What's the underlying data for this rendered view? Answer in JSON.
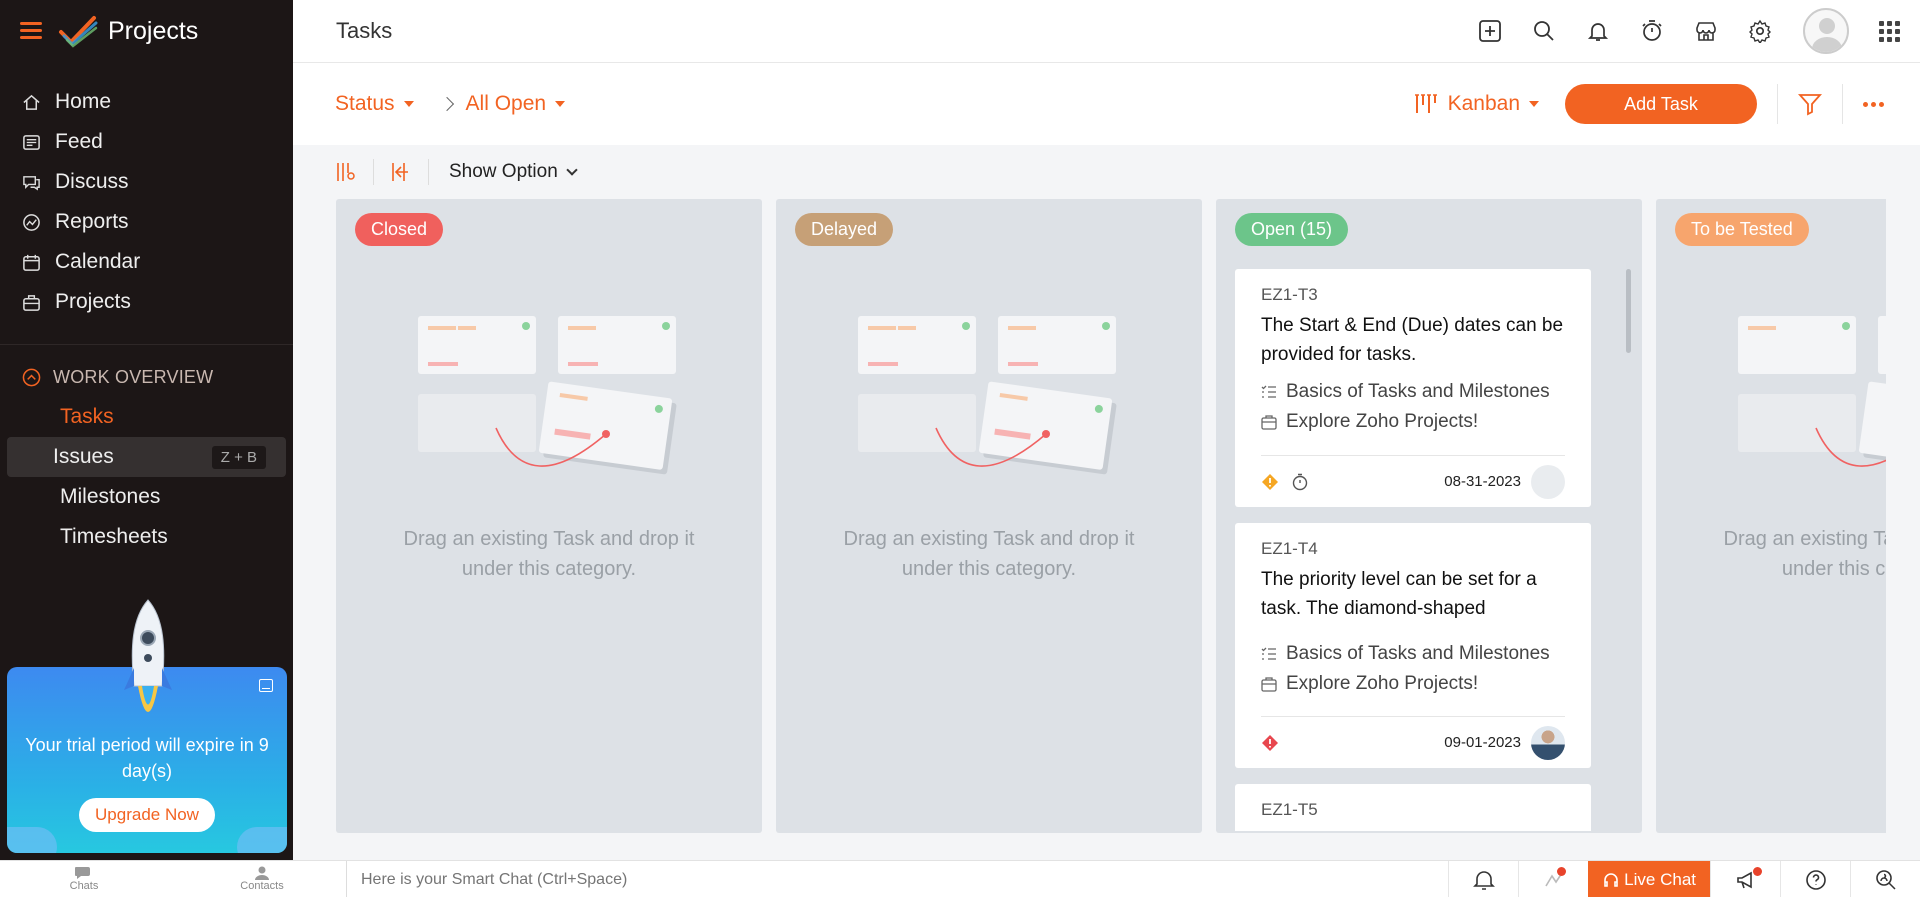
{
  "app": {
    "title": "Projects"
  },
  "sidebar": {
    "nav": [
      {
        "label": "Home",
        "icon": "home-icon"
      },
      {
        "label": "Feed",
        "icon": "feed-icon"
      },
      {
        "label": "Discuss",
        "icon": "discuss-icon"
      },
      {
        "label": "Reports",
        "icon": "reports-icon"
      },
      {
        "label": "Calendar",
        "icon": "calendar-icon"
      },
      {
        "label": "Projects",
        "icon": "projects-icon"
      }
    ],
    "section": {
      "title": "WORK OVERVIEW",
      "items": [
        {
          "label": "Tasks",
          "active": true
        },
        {
          "label": "Issues",
          "shortcut": "Z + B"
        },
        {
          "label": "Milestones"
        },
        {
          "label": "Timesheets"
        }
      ]
    },
    "trial": {
      "text": "Your trial period will expire in 9 day(s)",
      "button": "Upgrade Now"
    }
  },
  "header": {
    "title": "Tasks"
  },
  "filterbar": {
    "status": "Status",
    "filter": "All Open",
    "view": "Kanban",
    "add_task": "Add Task"
  },
  "optbar": {
    "show_option": "Show Option"
  },
  "columns": [
    {
      "label": "Closed",
      "color": "#f0605d",
      "hint": "Drag an existing Task and drop it under this category."
    },
    {
      "label": "Delayed",
      "color": "#c6a077",
      "hint": "Drag an existing Task and drop it under this category."
    },
    {
      "label": "Open (15)",
      "color": "#6cc58a"
    },
    {
      "label": "To be Tested",
      "color": "#f7a56d",
      "hint": "Drag an existing Task and drop it under this category."
    }
  ],
  "cards": [
    {
      "id": "EZ1-T3",
      "title": "The Start & End (Due) dates can be provided for tasks.",
      "tasklist": "Basics of Tasks and Milestones",
      "project": "Explore Zoho Projects!",
      "date": "08-31-2023",
      "priority_color": "#f5a623"
    },
    {
      "id": "EZ1-T4",
      "title": "The priority level can be set for a task. The diamond-shaped",
      "tasklist": "Basics of Tasks and Milestones",
      "project": "Explore Zoho Projects!",
      "date": "09-01-2023",
      "priority_color": "#e8474e"
    },
    {
      "id": "EZ1-T5"
    }
  ],
  "bottombar": {
    "chats": "Chats",
    "contacts": "Contacts",
    "smart_chat_placeholder": "Here is your Smart Chat (Ctrl+Space)",
    "live_chat": "Live Chat"
  },
  "colors": {
    "accent": "#f26322",
    "sidebar_bg": "#1c1616"
  }
}
